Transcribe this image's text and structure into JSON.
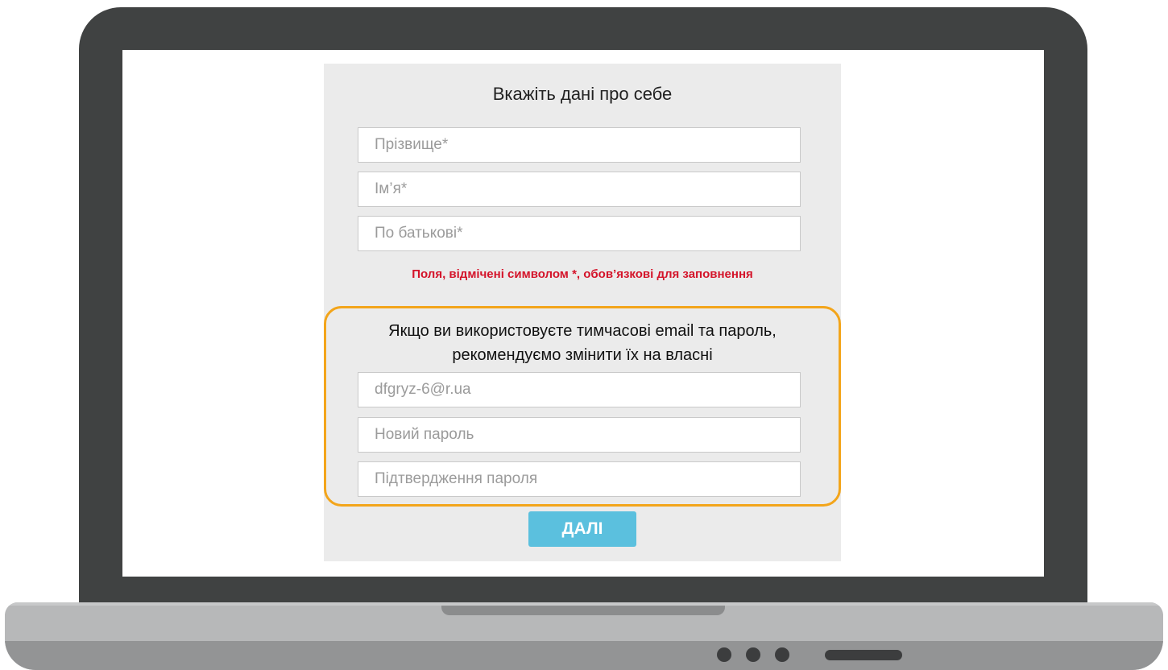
{
  "form": {
    "title": "Вкажіть дані про себе",
    "fields": {
      "surname": {
        "placeholder": "Прізвище*"
      },
      "first_name": {
        "placeholder": "Ім’я*"
      },
      "patronymic": {
        "placeholder": "По батькові*"
      }
    },
    "required_note": "Поля, відмічені символом *, обов’язкові для заповнення"
  },
  "credentials": {
    "note_line1": "Якщо ви використовуєте тимчасові email та пароль,",
    "note_line2": "рекомендуємо змінити їх на власні",
    "email": {
      "placeholder": "dfgryz-6@r.ua"
    },
    "new_password": {
      "placeholder": "Новий пароль"
    },
    "confirm_password": {
      "placeholder": "Підтвердження пароля"
    }
  },
  "actions": {
    "next_label": "ДАЛІ"
  },
  "colors": {
    "accent_button": "#5bc0de",
    "highlight_border": "#f3a51b",
    "error_text": "#d4142a",
    "laptop_bezel": "#404242"
  }
}
